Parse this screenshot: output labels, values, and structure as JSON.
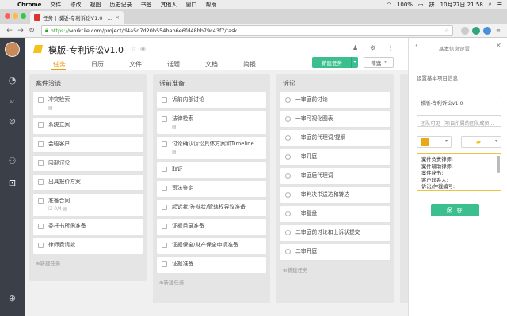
{
  "menubar": {
    "app": "Chrome",
    "items": [
      "文件",
      "修改",
      "视图",
      "历史记录",
      "书签",
      "其他人",
      "窗口",
      "帮助"
    ],
    "battery": "100%",
    "datetime": "10月27日 21:58"
  },
  "browser": {
    "tab_title": "任务 | 模版-专利诉讼V1.0 · ...",
    "url_scheme": "https://",
    "url_rest": "worktile.com/project/d4a5d7d20b554bab6e6fd48bb79c43f7/task"
  },
  "project": {
    "title": "模版-专利诉讼V1.0",
    "tabs": [
      "任务",
      "日历",
      "文件",
      "话题",
      "文档",
      "简报"
    ],
    "active_tab": "任务",
    "new_task_label": "新建任务",
    "filter_label": "筛选",
    "add_task_label": "新建任务",
    "accent": "#f39c12",
    "green": "#3bbf8f"
  },
  "columns": [
    {
      "name": "案件洽谈",
      "cards": [
        {
          "text": "冲突检索",
          "meta": "▤"
        },
        {
          "text": "系统立案"
        },
        {
          "text": "会晤客户"
        },
        {
          "text": "内部讨论"
        },
        {
          "text": "出具报价方案"
        },
        {
          "text": "准备合同",
          "meta": "☑ 0/4  ▤"
        },
        {
          "text": "委托书所函准备"
        },
        {
          "text": "律师费请款"
        }
      ]
    },
    {
      "name": "诉前准备",
      "cards": [
        {
          "text": "诉前内部讨论"
        },
        {
          "text": "法律检索",
          "meta": "▤"
        },
        {
          "text": "讨论确认诉讼具体方案和Timeline",
          "meta": "▤"
        },
        {
          "text": "取证"
        },
        {
          "text": "司法鉴定"
        },
        {
          "text": "起诉状/答辩状/管辖权异议准备"
        },
        {
          "text": "证据目录准备"
        },
        {
          "text": "证据保全/财产保全申请准备"
        },
        {
          "text": "证据准备"
        }
      ]
    },
    {
      "name": "诉讼",
      "cards": [
        {
          "text": "一审庭前讨论"
        },
        {
          "text": "一审可视化图表"
        },
        {
          "text": "一审庭前代理词/提纲"
        },
        {
          "text": "一审开庭"
        },
        {
          "text": "一审庭后代理词"
        },
        {
          "text": "一审判决书送达和转达"
        },
        {
          "text": "一审复盘"
        },
        {
          "text": "二审庭前讨论和上诉状提交"
        },
        {
          "text": "二审开庭"
        }
      ]
    }
  ],
  "panel": {
    "title": "基本信息设置",
    "subtitle": "设置基本项目信息",
    "name_value": "模版-专利诉讼V1.0",
    "visibility_placeholder": "团队可见（项目所属的团队成员...",
    "description_lines": [
      "案件负责律师:",
      "案件辅助律师:",
      "案件秘书:",
      "客户联系人:",
      "诉讼/仲裁编号:"
    ],
    "save_label": "保 存",
    "color": "#e8a916"
  }
}
